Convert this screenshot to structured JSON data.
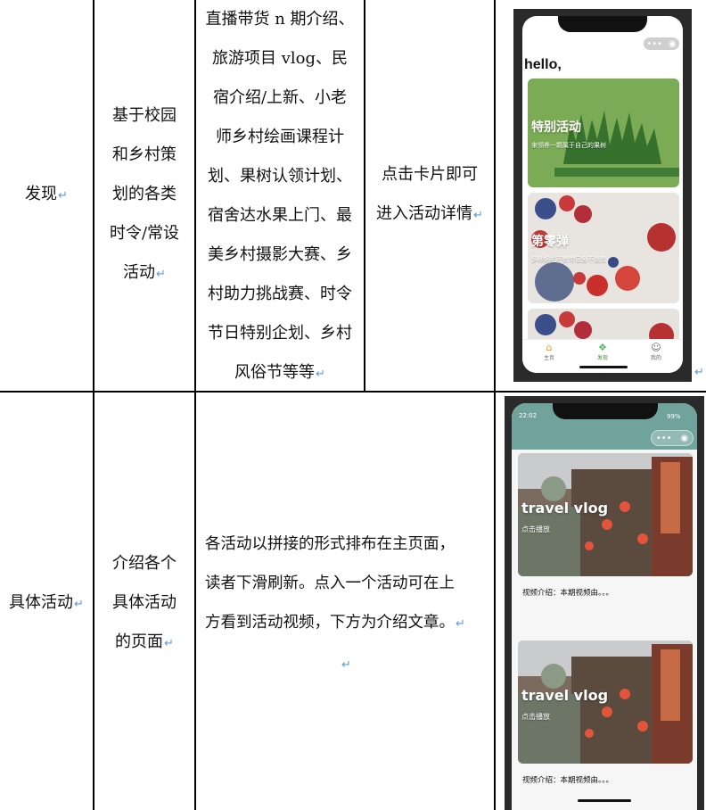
{
  "rows": [
    {
      "feature": "发现",
      "description": [
        "基于校园",
        "和乡村策",
        "划的各类",
        "时令/常设",
        "活动"
      ],
      "content": [
        "直播带货 n 期介绍、",
        "旅游项目 vlog、民",
        "宿介绍/上新、小老",
        "师乡村绘画课程计",
        "划、果树认领计划、",
        "宿舍达水果上门、最",
        "美乡村摄影大赛、乡",
        "村助力挑战赛、时令",
        "节日特别企划、乡村",
        "风俗节等等"
      ],
      "interaction": [
        "点击卡片即可",
        "进入活动详情"
      ]
    },
    {
      "feature": "具体活动",
      "description": [
        "介绍各个",
        "具体活动",
        "的页面"
      ],
      "content": [
        "各活动以拼接的形式排布在主页面，",
        "读者下滑刷新。点入一个活动可在上",
        "方看到活动视频，下方为介绍文章。"
      ]
    }
  ],
  "return_mark": "↵",
  "phone1": {
    "capsule": "•••",
    "greeting": "hello,",
    "cards": [
      {
        "title": "特别活动",
        "subtitle": "来领养一颗属于自己的果树"
      },
      {
        "title": "第零弹",
        "subtitle": "多种好吃不贵带宿舍不浪费"
      }
    ],
    "tabs": [
      {
        "icon": "home-icon",
        "label": "主页"
      },
      {
        "icon": "discover-icon",
        "label": "发现"
      },
      {
        "icon": "profile-icon",
        "label": "我的"
      }
    ],
    "accent": "#7cab55"
  },
  "phone2": {
    "time": "22:02",
    "battery": "99%",
    "capsule": "•••",
    "header_color": "#6fa39c",
    "videos": [
      {
        "title": "travel vlog",
        "subtitle": "点击播放",
        "desc": "视频介绍：本期视频由。。。"
      },
      {
        "title": "travel vlog",
        "subtitle": "点击播放",
        "desc": "视频介绍：本期视频由。。。"
      }
    ]
  }
}
